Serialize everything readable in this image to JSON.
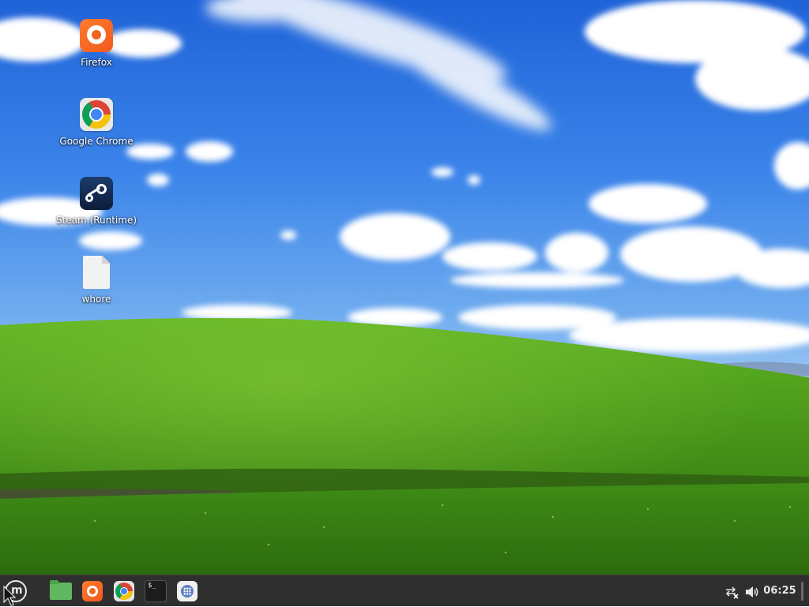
{
  "desktop": {
    "icons": [
      {
        "label": "Firefox",
        "icon": "firefox-icon"
      },
      {
        "label": "Google Chrome",
        "icon": "chrome-icon"
      },
      {
        "label": "Steam (Runtime)",
        "icon": "steam-icon"
      },
      {
        "label": "whore",
        "icon": "file-icon"
      }
    ]
  },
  "taskbar": {
    "menu_icon": "mint-menu-icon",
    "launchers": [
      {
        "icon": "folder-icon"
      },
      {
        "icon": "firefox-icon"
      },
      {
        "icon": "chrome-icon"
      },
      {
        "icon": "terminal-icon"
      },
      {
        "icon": "app-grid-icon"
      }
    ],
    "terminal_prompt": "$_",
    "tray": {
      "network_icon": "network-disconnected-icon",
      "volume_icon": "volume-icon"
    },
    "clock": "06:25"
  },
  "colors": {
    "panel": "#2f2f2f",
    "sky_top": "#1f63d8",
    "grass": "#4a9a1a"
  }
}
